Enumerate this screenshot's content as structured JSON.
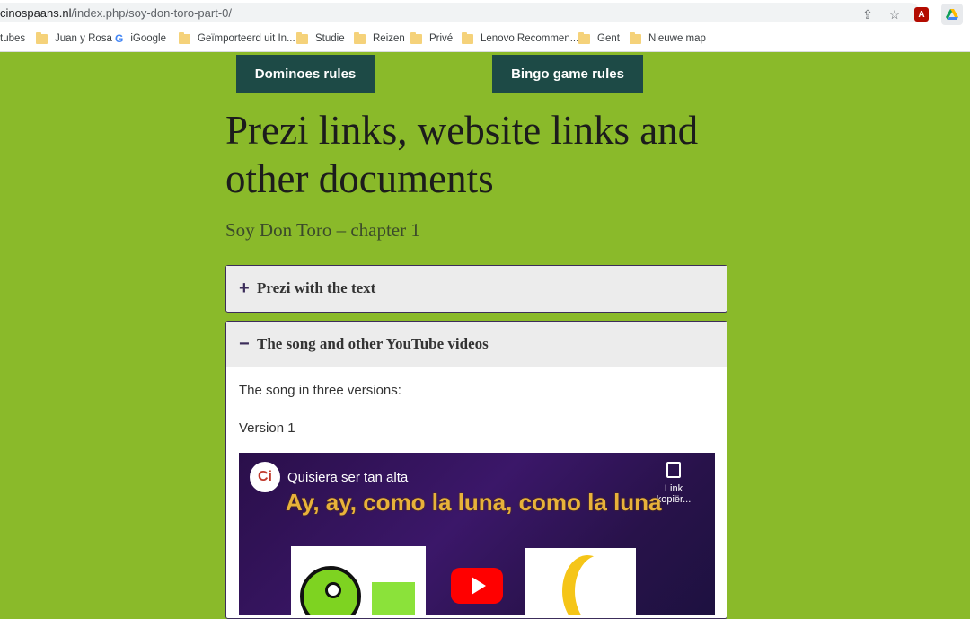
{
  "browser": {
    "url_main": "cinospaans.nl",
    "url_path": "/index.php/soy-don-toro-part-0/",
    "pdf_ext_label": "A"
  },
  "bookmarks": [
    {
      "label": "tubes",
      "icon": "none"
    },
    {
      "label": "Juan y Rosa",
      "icon": "folder"
    },
    {
      "label": "iGoogle",
      "icon": "google"
    },
    {
      "label": "Geïmporteerd uit In...",
      "icon": "folder"
    },
    {
      "label": "Studie",
      "icon": "folder"
    },
    {
      "label": "Reizen",
      "icon": "folder"
    },
    {
      "label": "Privé",
      "icon": "folder"
    },
    {
      "label": "Lenovo Recommen...",
      "icon": "folder"
    },
    {
      "label": "Gent",
      "icon": "folder"
    },
    {
      "label": "Nieuwe map",
      "icon": "folder"
    }
  ],
  "buttons": {
    "dominoes": "Dominoes rules",
    "bingo": "Bingo game rules"
  },
  "page": {
    "title": "Prezi links, website links and other documents",
    "subtitle": "Soy Don Toro – chapter 1"
  },
  "accordion": [
    {
      "sign": "+",
      "title": "Prezi with the text",
      "expanded": false
    },
    {
      "sign": "−",
      "title": "The song and other YouTube videos",
      "expanded": true
    }
  ],
  "content": {
    "intro": "The song in three versions:",
    "version": "Version 1"
  },
  "video": {
    "channel_logo": "Ci",
    "title": "Quisiera ser tan alta",
    "copy_label": "Link kopiër...",
    "lyric": "Ay, ay, como la luna, como la luna"
  },
  "colors": {
    "page_bg": "#8aba2a",
    "button_bg": "#1d4a46",
    "accordion_border": "#3c2d5a",
    "youtube_red": "#ff0000"
  }
}
